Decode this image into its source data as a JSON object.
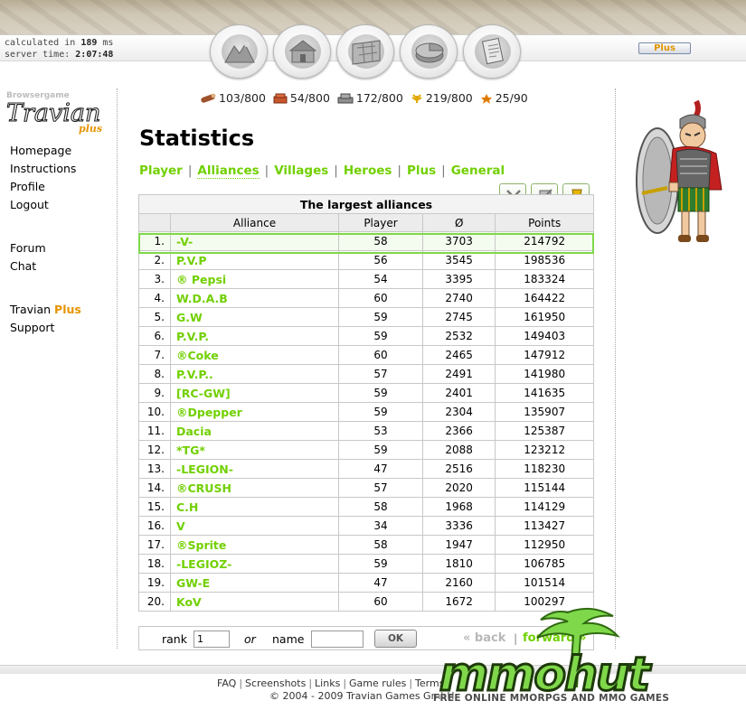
{
  "server": {
    "calc_label": "calculated in",
    "calc_value": "189",
    "calc_unit": "ms",
    "time_label": "server time:",
    "time_value": "2:07:48",
    "plus_button": "Plus"
  },
  "nav_icons": [
    "village-overview-icon",
    "village-center-icon",
    "map-icon",
    "statistics-icon",
    "reports-icon"
  ],
  "logo": {
    "top_text": "Browsergame",
    "brand": "Travian",
    "suffix": "plus"
  },
  "menu": {
    "homepage": "Homepage",
    "instructions": "Instructions",
    "profile": "Profile",
    "logout": "Logout",
    "forum": "Forum",
    "chat": "Chat",
    "travian": "Travian",
    "plus": "Plus",
    "support": "Support"
  },
  "resources": [
    {
      "name": "wood",
      "value": "103/800"
    },
    {
      "name": "clay",
      "value": "54/800"
    },
    {
      "name": "iron",
      "value": "172/800"
    },
    {
      "name": "crop",
      "value": "219/800"
    },
    {
      "name": "consumption",
      "value": "25/90"
    }
  ],
  "page_title": "Statistics",
  "tabs": [
    "Player",
    "Alliances",
    "Villages",
    "Heroes",
    "Plus",
    "General"
  ],
  "table": {
    "caption": "The largest alliances",
    "columns": [
      "",
      "Alliance",
      "Player",
      "Ø",
      "Points"
    ],
    "rows": [
      {
        "rank": "1.",
        "name": "-V-",
        "players": "58",
        "avg": "3703",
        "points": "214792"
      },
      {
        "rank": "2.",
        "name": "P.V.P",
        "players": "56",
        "avg": "3545",
        "points": "198536"
      },
      {
        "rank": "3.",
        "name": "® Pepsi",
        "players": "54",
        "avg": "3395",
        "points": "183324"
      },
      {
        "rank": "4.",
        "name": "W.D.A.B",
        "players": "60",
        "avg": "2740",
        "points": "164422"
      },
      {
        "rank": "5.",
        "name": "G.W",
        "players": "59",
        "avg": "2745",
        "points": "161950"
      },
      {
        "rank": "6.",
        "name": "P.V.P.",
        "players": "59",
        "avg": "2532",
        "points": "149403"
      },
      {
        "rank": "7.",
        "name": "®Coke",
        "players": "60",
        "avg": "2465",
        "points": "147912"
      },
      {
        "rank": "8.",
        "name": "P.V.P..",
        "players": "57",
        "avg": "2491",
        "points": "141980"
      },
      {
        "rank": "9.",
        "name": "[RC-GW]",
        "players": "59",
        "avg": "2401",
        "points": "141635"
      },
      {
        "rank": "10.",
        "name": "®Dpepper",
        "players": "59",
        "avg": "2304",
        "points": "135907"
      },
      {
        "rank": "11.",
        "name": "Dacia",
        "players": "53",
        "avg": "2366",
        "points": "125387"
      },
      {
        "rank": "12.",
        "name": "*TG*",
        "players": "59",
        "avg": "2088",
        "points": "123212"
      },
      {
        "rank": "13.",
        "name": "-LEGION-",
        "players": "47",
        "avg": "2516",
        "points": "118230"
      },
      {
        "rank": "14.",
        "name": "®CRUSH",
        "players": "57",
        "avg": "2020",
        "points": "115144"
      },
      {
        "rank": "15.",
        "name": "C.H",
        "players": "58",
        "avg": "1968",
        "points": "114129"
      },
      {
        "rank": "16.",
        "name": "V",
        "players": "34",
        "avg": "3336",
        "points": "113427"
      },
      {
        "rank": "17.",
        "name": "®Sprite",
        "players": "58",
        "avg": "1947",
        "points": "112950"
      },
      {
        "rank": "18.",
        "name": "-LEGIOZ-",
        "players": "59",
        "avg": "1810",
        "points": "106785"
      },
      {
        "rank": "19.",
        "name": "GW-E",
        "players": "47",
        "avg": "2160",
        "points": "101514"
      },
      {
        "rank": "20.",
        "name": "KoV",
        "players": "60",
        "avg": "1672",
        "points": "100297"
      }
    ]
  },
  "search": {
    "rank_label": "rank",
    "rank_value": "1",
    "or_label": "or",
    "name_label": "name",
    "name_value": "",
    "ok_button": "OK",
    "back": "« back",
    "separator": "|",
    "forward": "forward »"
  },
  "footer": {
    "links": [
      "FAQ",
      "Screenshots",
      "Links",
      "Game rules",
      "Terms"
    ],
    "copyright": "© 2004 - 2009 Travian Games GmbH"
  },
  "watermark": {
    "brand": "mmohut",
    "tagline": "FREE ONLINE MMORPGS AND MMO GAMES"
  },
  "colors": {
    "accent_green": "#71d000",
    "plus_orange": "#e59400",
    "highlight_border": "#7fd84a"
  }
}
